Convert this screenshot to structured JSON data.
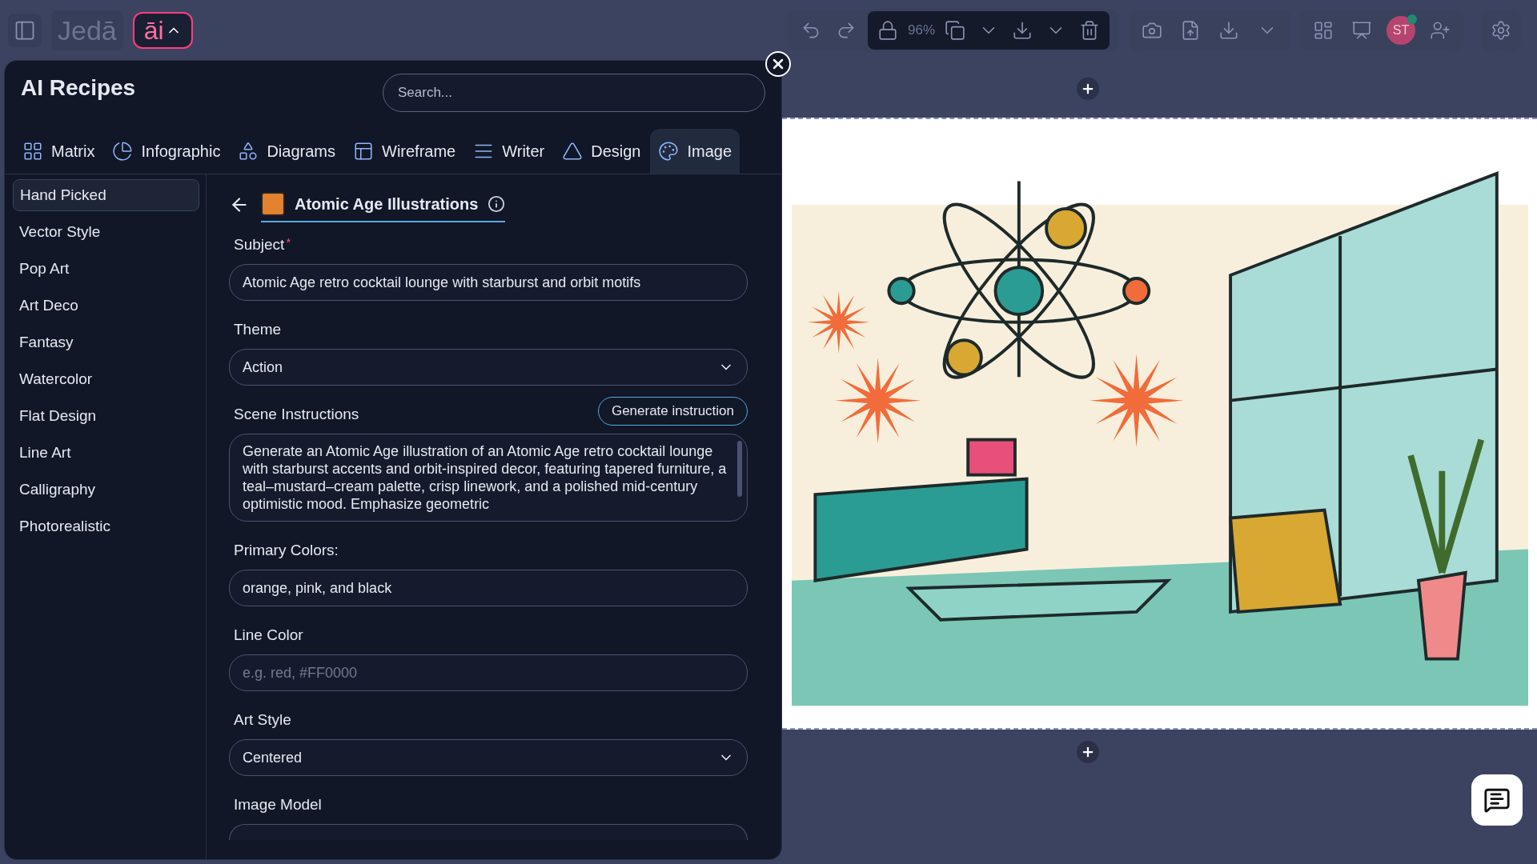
{
  "app_bar": {
    "logo": "Jedā",
    "ai_button": "āi"
  },
  "toolbar": {
    "zoom": "96%",
    "avatar": "ST"
  },
  "panel": {
    "title": "AI Recipes",
    "search": {
      "placeholder": "Search..."
    },
    "tabs": [
      {
        "label": "Matrix",
        "selected": false
      },
      {
        "label": "Infographic",
        "selected": false
      },
      {
        "label": "Diagrams",
        "selected": false
      },
      {
        "label": "Wireframe",
        "selected": false
      },
      {
        "label": "Writer",
        "selected": false
      },
      {
        "label": "Design",
        "selected": false
      },
      {
        "label": "Image",
        "selected": true
      }
    ],
    "sidebar": {
      "items": [
        {
          "label": "Hand Picked",
          "selected": true
        },
        {
          "label": "Vector Style",
          "selected": false
        },
        {
          "label": "Pop Art",
          "selected": false
        },
        {
          "label": "Art Deco",
          "selected": false
        },
        {
          "label": "Fantasy",
          "selected": false
        },
        {
          "label": "Watercolor",
          "selected": false
        },
        {
          "label": "Flat Design",
          "selected": false
        },
        {
          "label": "Line Art",
          "selected": false
        },
        {
          "label": "Calligraphy",
          "selected": false
        },
        {
          "label": "Photorealistic",
          "selected": false
        }
      ]
    },
    "recipe": {
      "title": "Atomic Age Illustrations",
      "fields": [
        {
          "kind": "input",
          "label": "Subject",
          "required_mark": "*",
          "value": "Atomic Age retro cocktail lounge with starburst and orbit motifs"
        },
        {
          "kind": "select",
          "label": "Theme",
          "value": "Action"
        },
        {
          "kind": "textarea",
          "label": "Scene Instructions",
          "button": "Generate instruction",
          "value": "Generate an Atomic Age illustration of an Atomic Age retro cocktail lounge with starburst accents and orbit-inspired decor, featuring tapered furniture, a teal–mustard–cream palette, crisp linework, and a polished mid-century optimistic mood. Emphasize geometric"
        },
        {
          "kind": "input",
          "label": "Primary Colors:",
          "value": "orange, pink, and black"
        },
        {
          "kind": "input",
          "label": "Line Color",
          "placeholder": "e.g. red, #FF0000"
        },
        {
          "kind": "select",
          "label": "Art Style",
          "value": "Centered"
        },
        {
          "kind": "model",
          "label": "Image Model"
        }
      ]
    }
  }
}
